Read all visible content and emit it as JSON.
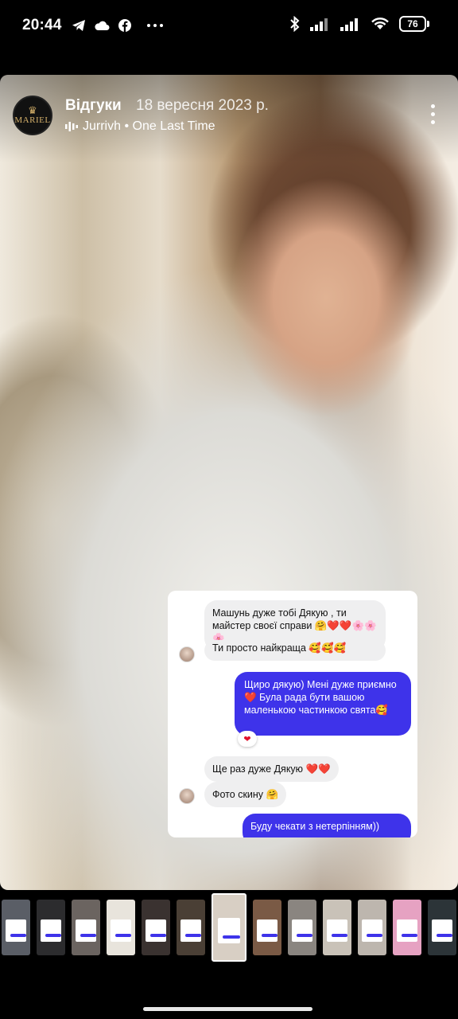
{
  "status_bar": {
    "time": "20:44",
    "left_icons": [
      "telegram-icon",
      "cloud-icon",
      "facebook-icon",
      "more-horizontal-icon"
    ],
    "right_icons": [
      "bluetooth-icon",
      "signal-icon",
      "signal-icon",
      "wifi-icon"
    ],
    "battery": "76"
  },
  "story": {
    "account_logo_text": "MARIEL",
    "title": "Відгуки",
    "date": "18 вересня 2023 р.",
    "music": "Jurrivh • One Last Time"
  },
  "chat": {
    "messages": [
      {
        "side": "in",
        "text": "Машунь дуже тобі Дякую , ти майстер своєї справи 🤗❤️❤️🌸🌸🌸"
      },
      {
        "side": "in",
        "text": "Ти просто найкраща 🥰🥰🥰"
      },
      {
        "side": "out",
        "text": "Щиро дякую) Мені дуже приємно ❤️ Була рада бути вашою маленькою частинкою свята🥰"
      },
      {
        "side": "in",
        "text": "Ще раз дуже Дякую ❤️❤️"
      },
      {
        "side": "in",
        "text": "Фото скину 🤗"
      },
      {
        "side": "out",
        "text": "Буду чекати з нетерпінням))"
      }
    ],
    "reaction": "❤"
  },
  "thumbnails": {
    "count": 13,
    "active_index": 6,
    "colors": [
      "#5a5e66",
      "#2c2c2e",
      "#6b6460",
      "#e8e4dc",
      "#3a3230",
      "#4a3f35",
      "#d8cfc4",
      "#7a5a45",
      "#8a8580",
      "#c9c2b8",
      "#bdb6ae",
      "#e6a2c2",
      "#2c3438"
    ]
  },
  "colors": {
    "chat_outgoing": "#3e33ea",
    "chat_incoming": "#efeff0",
    "logo_gold": "#d4b06a"
  }
}
